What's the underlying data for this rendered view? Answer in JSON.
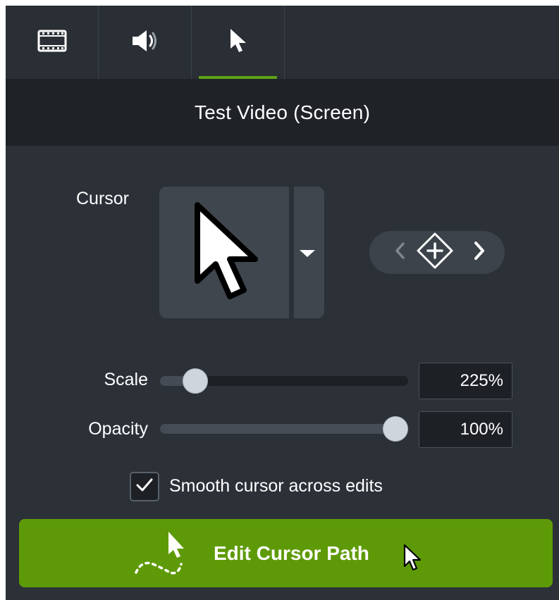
{
  "tabs": [
    {
      "id": "media",
      "icon": "film-strip-icon"
    },
    {
      "id": "audio",
      "icon": "speaker-icon"
    },
    {
      "id": "cursor",
      "icon": "cursor-arrow-icon",
      "active": true
    }
  ],
  "header": {
    "title": "Test Video (Screen)"
  },
  "cursor_section": {
    "label": "Cursor",
    "preview_icon": "arrow-cursor-icon",
    "dropdown_icon": "caret-down-icon",
    "keyframes": {
      "prev_icon": "chevron-left-icon",
      "add_icon": "add-keyframe-diamond-icon",
      "next_icon": "chevron-right-icon"
    }
  },
  "scale": {
    "label": "Scale",
    "value": "225%",
    "slider_fraction": 0.1
  },
  "opacity": {
    "label": "Opacity",
    "value": "100%",
    "slider_fraction": 1.0
  },
  "smooth": {
    "label": "Smooth cursor across edits",
    "checked": true
  },
  "edit_button": {
    "label": "Edit Cursor Path",
    "icon": "cursor-path-icon"
  },
  "colors": {
    "panel_bg": "#2c3138",
    "header_bg": "#1f2328",
    "accent_green": "#5e9a08",
    "active_tab_underline": "#5fa316"
  }
}
